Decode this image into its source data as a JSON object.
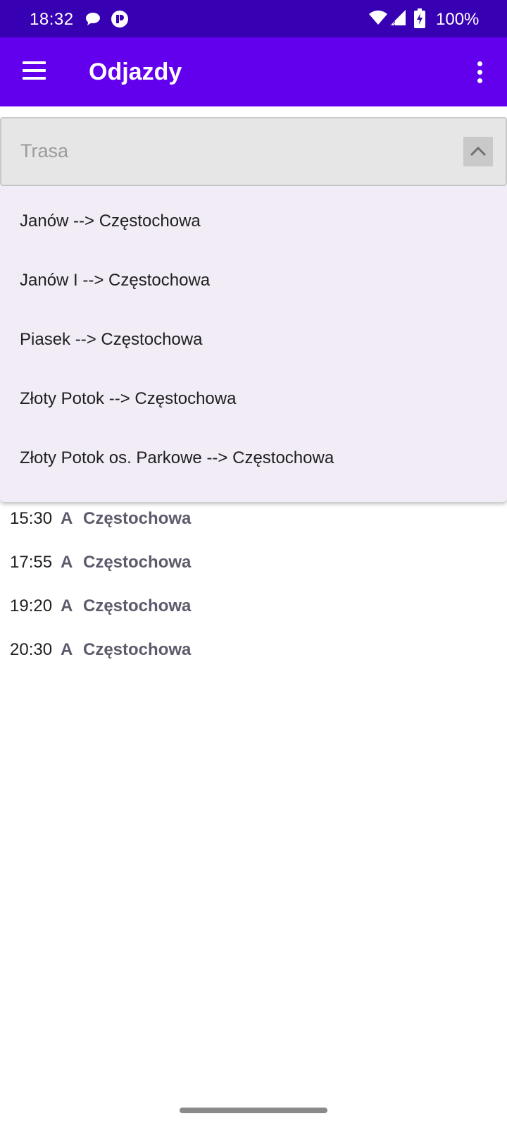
{
  "status_bar": {
    "time": "18:32",
    "battery": "100%",
    "icons": [
      "chat-bubble-icon",
      "notification-app-icon",
      "wifi-icon",
      "signal-icon",
      "battery-charging-icon"
    ]
  },
  "app_bar": {
    "title": "Odjazdy",
    "menu_icon": "hamburger-menu-icon",
    "overflow_icon": "more-vert-icon",
    "color": "#6200ee"
  },
  "route_spinner": {
    "placeholder": "Trasa",
    "expanded": true,
    "options": [
      "Janów --> Częstochowa",
      "Janów I --> Częstochowa",
      "Piasek --> Częstochowa",
      "Złoty Potok --> Częstochowa",
      "Złoty Potok os. Parkowe --> Częstochowa"
    ]
  },
  "departures": [
    {
      "time": "15:30",
      "line": "A",
      "destination": "Częstochowa"
    },
    {
      "time": "17:55",
      "line": "A",
      "destination": "Częstochowa"
    },
    {
      "time": "19:20",
      "line": "A",
      "destination": "Częstochowa"
    },
    {
      "time": "20:30",
      "line": "A",
      "destination": "Częstochowa"
    }
  ],
  "colors": {
    "status_bar": "#3700b3",
    "app_bar": "#6200ee",
    "dropdown_bg": "#f1ecf6",
    "departure_text": "#5f5a6b"
  }
}
